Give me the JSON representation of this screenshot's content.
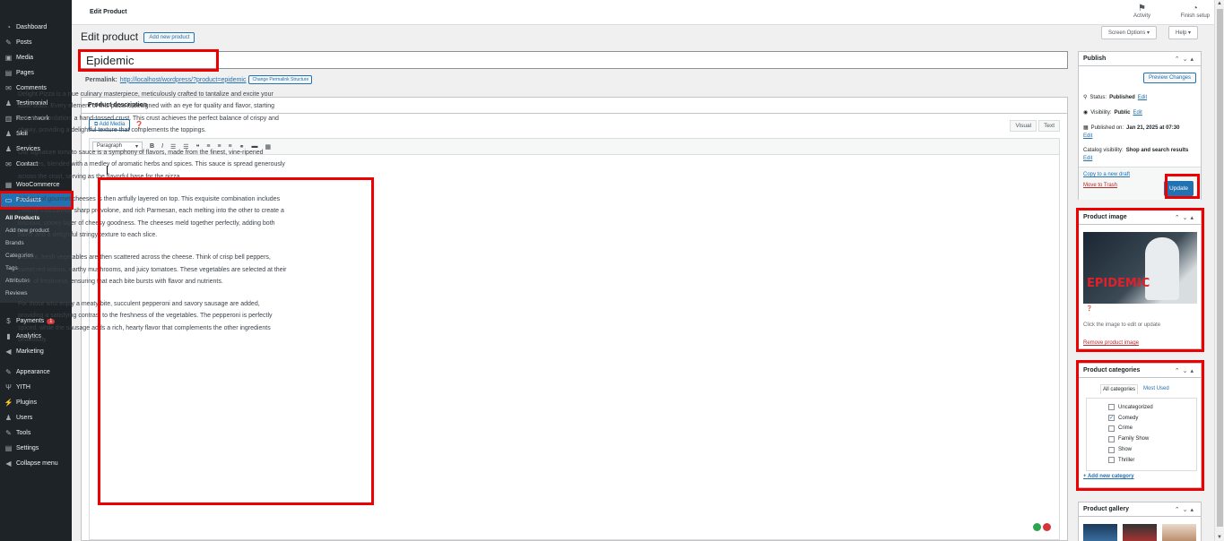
{
  "sidebar": {
    "items": [
      {
        "label": "Dashboard",
        "icon": "dashboard-icon",
        "glyph": "◔"
      },
      {
        "label": "Posts",
        "icon": "pin-icon",
        "glyph": "✎"
      },
      {
        "label": "Media",
        "icon": "media-icon",
        "glyph": "▣"
      },
      {
        "label": "Pages",
        "icon": "pages-icon",
        "glyph": "▤"
      },
      {
        "label": "Comments",
        "icon": "comments-icon",
        "glyph": "✉"
      },
      {
        "label": "Testimonial",
        "icon": "user-icon",
        "glyph": "♟"
      },
      {
        "label": "Recentwork",
        "icon": "chart-icon",
        "glyph": "▥"
      },
      {
        "label": "Skill",
        "icon": "user-icon",
        "glyph": "♟"
      },
      {
        "label": "Services",
        "icon": "user-icon",
        "glyph": "♟"
      },
      {
        "label": "Contact",
        "icon": "mail-icon",
        "glyph": "✉"
      },
      {
        "label": "WooCommerce",
        "icon": "woo-icon",
        "glyph": "▦"
      },
      {
        "label": "Products",
        "icon": "products-icon",
        "glyph": "▭"
      }
    ],
    "submenu": [
      "All Products",
      "Add new product",
      "Brands",
      "Categories",
      "Tags",
      "Attributes",
      "Reviews"
    ],
    "items2": [
      {
        "label": "Payments",
        "icon": "payments-icon",
        "glyph": "$",
        "badge": "1"
      },
      {
        "label": "Analytics",
        "icon": "analytics-icon",
        "glyph": "▮"
      },
      {
        "label": "Marketing",
        "icon": "megaphone-icon",
        "glyph": "◀"
      },
      {
        "label": "Appearance",
        "icon": "brush-icon",
        "glyph": "✎"
      },
      {
        "label": "YITH",
        "icon": "yith-icon",
        "glyph": "Ψ"
      },
      {
        "label": "Plugins",
        "icon": "plugin-icon",
        "glyph": "⚡"
      },
      {
        "label": "Users",
        "icon": "users-icon",
        "glyph": "♟"
      },
      {
        "label": "Tools",
        "icon": "wrench-icon",
        "glyph": "✎"
      },
      {
        "label": "Settings",
        "icon": "settings-icon",
        "glyph": "▤"
      },
      {
        "label": "Collapse menu",
        "icon": "collapse-icon",
        "glyph": "◀"
      }
    ]
  },
  "topbar": {
    "title": "Edit Product",
    "activity": "Activity",
    "finish": "Finish setup"
  },
  "page": {
    "heading": "Edit product",
    "add_new": "Add new product",
    "screen_options": "Screen Options ▾",
    "help": "Help ▾",
    "product_title": "Epidemic",
    "permalink_label": "Permalink:",
    "permalink_url": "http://localhost/wordpress/?product=epidemic",
    "change_permalink": "Change Permalink Structure"
  },
  "editor": {
    "box_title": "Product description",
    "add_media": "Add Media",
    "visual": "Visual",
    "text": "Text",
    "format": "Paragraph",
    "paragraphs": [
      "Delight Pizza is a true culinary masterpiece, meticulously crafted to tantalize and excite your taste buds. Every element of this pizza is designed with an eye for quality and flavor, starting with the foundation: a hand-tossed crust. This crust achieves the perfect balance of crispy and chewy, providing a delightful texture that complements the toppings.",
      "Our signature tomato sauce is a symphony of flavors, made from the finest, vine-ripened tomatoes, blended with a medley of aromatic herbs and spices. This sauce is spread generously across the crust, serving as the flavorful base for the pizza.",
      "A blend of gourmet cheeses is then artfully layered on top. This exquisite combination includes creamy mozzarella, sharp provolone, and rich Parmesan, each melting into the other to create a luscious, gooey layer of cheesy goodness. The cheeses meld together perfectly, adding both flavor and a delightful stringy texture to each slice.",
      "Vibrant, fresh vegetables are then scattered across the cheese. Think of crisp bell peppers, sweet red onions, earthy mushrooms, and juicy tomatoes. These vegetables are selected at their peak of freshness, ensuring that each bite bursts with flavor and nutrients.",
      "For those who enjoy a meaty bite, succulent pepperoni and savory sausage are added, providing a satisfying contrast to the freshness of the vegetables. The pepperoni is perfectly spiced, while the sausage adds a rich, hearty flavor that complements the other ingredients beautifully."
    ]
  },
  "publish": {
    "title": "Publish",
    "preview": "Preview Changes",
    "status_label": "Status:",
    "status_value": "Published",
    "visibility_label": "Visibility:",
    "visibility_value": "Public",
    "published_label": "Published on:",
    "published_value": "Jan 21, 2025 at 07:30",
    "catalog_label": "Catalog visibility:",
    "catalog_value": "Shop and search results",
    "edit": "Edit",
    "copy_draft": "Copy to a new draft",
    "trash": "Move to Trash",
    "update": "Update"
  },
  "product_image": {
    "title": "Product image",
    "image_text": "EPIDEMIC",
    "hint": "Click the image to edit or update",
    "remove": "Remove product image"
  },
  "categories": {
    "title": "Product categories",
    "tab_all": "All categories",
    "tab_most": "Most Used",
    "items": [
      {
        "label": "Uncategorized",
        "checked": false
      },
      {
        "label": "Comedy",
        "checked": true
      },
      {
        "label": "Crime",
        "checked": false
      },
      {
        "label": "Family Show",
        "checked": false
      },
      {
        "label": "Show",
        "checked": false
      },
      {
        "label": "Thriller",
        "checked": false
      }
    ],
    "add_new": "+ Add new category"
  },
  "gallery": {
    "title": "Product gallery"
  },
  "colors": {
    "accent": "#2271b1",
    "highlight": "#e00000",
    "sidebar": "#1d2327"
  }
}
